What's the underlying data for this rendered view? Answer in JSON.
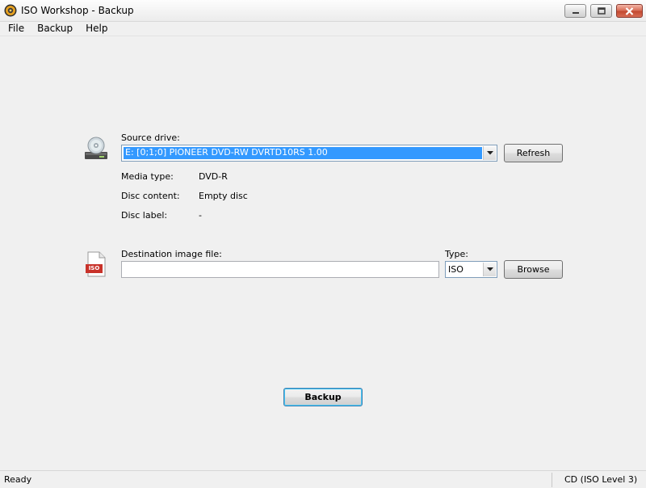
{
  "window": {
    "title": "ISO Workshop - Backup",
    "app_icon": "cd-disc-icon"
  },
  "menu": {
    "items": [
      "File",
      "Backup",
      "Help"
    ]
  },
  "source": {
    "label": "Source drive:",
    "drive_value": "E:  [0;1;0] PIONEER DVD-RW DVRTD10RS 1.00",
    "refresh_label": "Refresh",
    "icon": "optical-drive-icon"
  },
  "info": {
    "media_type_label": "Media type:",
    "media_type_value": "DVD-R",
    "disc_content_label": "Disc content:",
    "disc_content_value": "Empty disc",
    "disc_label_label": "Disc label:",
    "disc_label_value": "-"
  },
  "destination": {
    "label": "Destination image file:",
    "value": "",
    "type_label": "Type:",
    "type_value": "ISO",
    "browse_label": "Browse",
    "icon": "iso-file-icon",
    "icon_text": "ISO"
  },
  "action": {
    "backup_label": "Backup"
  },
  "status": {
    "left": "Ready",
    "right": "CD (ISO Level 3)"
  },
  "colors": {
    "selection": "#3399ff",
    "default_button_border": "#3c7fb1",
    "close_button": "#c34a30"
  }
}
